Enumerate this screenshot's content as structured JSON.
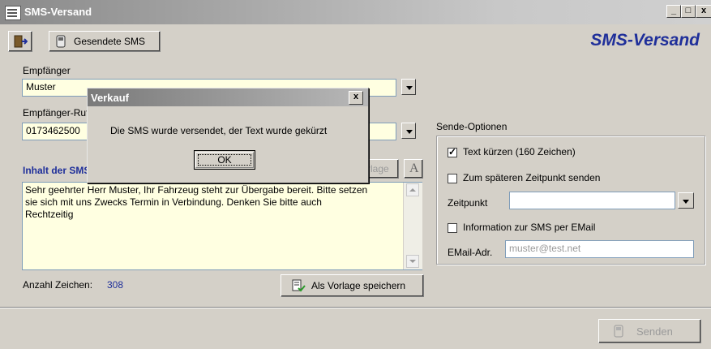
{
  "window": {
    "title": "SMS-Versand",
    "minimize": "_",
    "maximize": "□",
    "close": "x"
  },
  "toolbar": {
    "sent_sms_label": "Gesendete SMS",
    "brand": "SMS-Versand"
  },
  "form": {
    "recipient_label": "Empfänger",
    "recipient_value": "Muster",
    "recipient_number_label": "Empfänger-Rufnummer",
    "recipient_number_value": "0173462500",
    "content_heading": "Inhalt der SMS",
    "template_button": "Vorlage",
    "font_button": "A",
    "message_line1": "Sehr geehrter Herr Muster, Ihr Fahrzeug steht zur Übergabe bereit. Bitte setzen",
    "message_line2": "sie sich mit uns Zwecks Termin in Verbindung. Denken Sie bitte auch",
    "message_line3": "Rechtzeitig",
    "char_count_label": "Anzahl Zeichen:",
    "char_count_value": "308",
    "save_template_button": "Als Vorlage speichern"
  },
  "options": {
    "title": "Sende-Optionen",
    "shorten_text": "Text kürzen (160 Zeichen)",
    "shorten_checked": true,
    "send_later": "Zum späteren Zeitpunkt senden",
    "send_later_checked": false,
    "time_label": "Zeitpunkt",
    "time_value": "",
    "email_info": "Information zur SMS per EMail",
    "email_info_checked": false,
    "email_label": "EMail-Adr.",
    "email_placeholder": "muster@test.net"
  },
  "footer": {
    "send_button": "Senden"
  },
  "dialog": {
    "title": "Verkauf",
    "message": "Die SMS wurde versendet, der Text wurde gekürzt",
    "ok_label": "OK",
    "close": "x"
  }
}
